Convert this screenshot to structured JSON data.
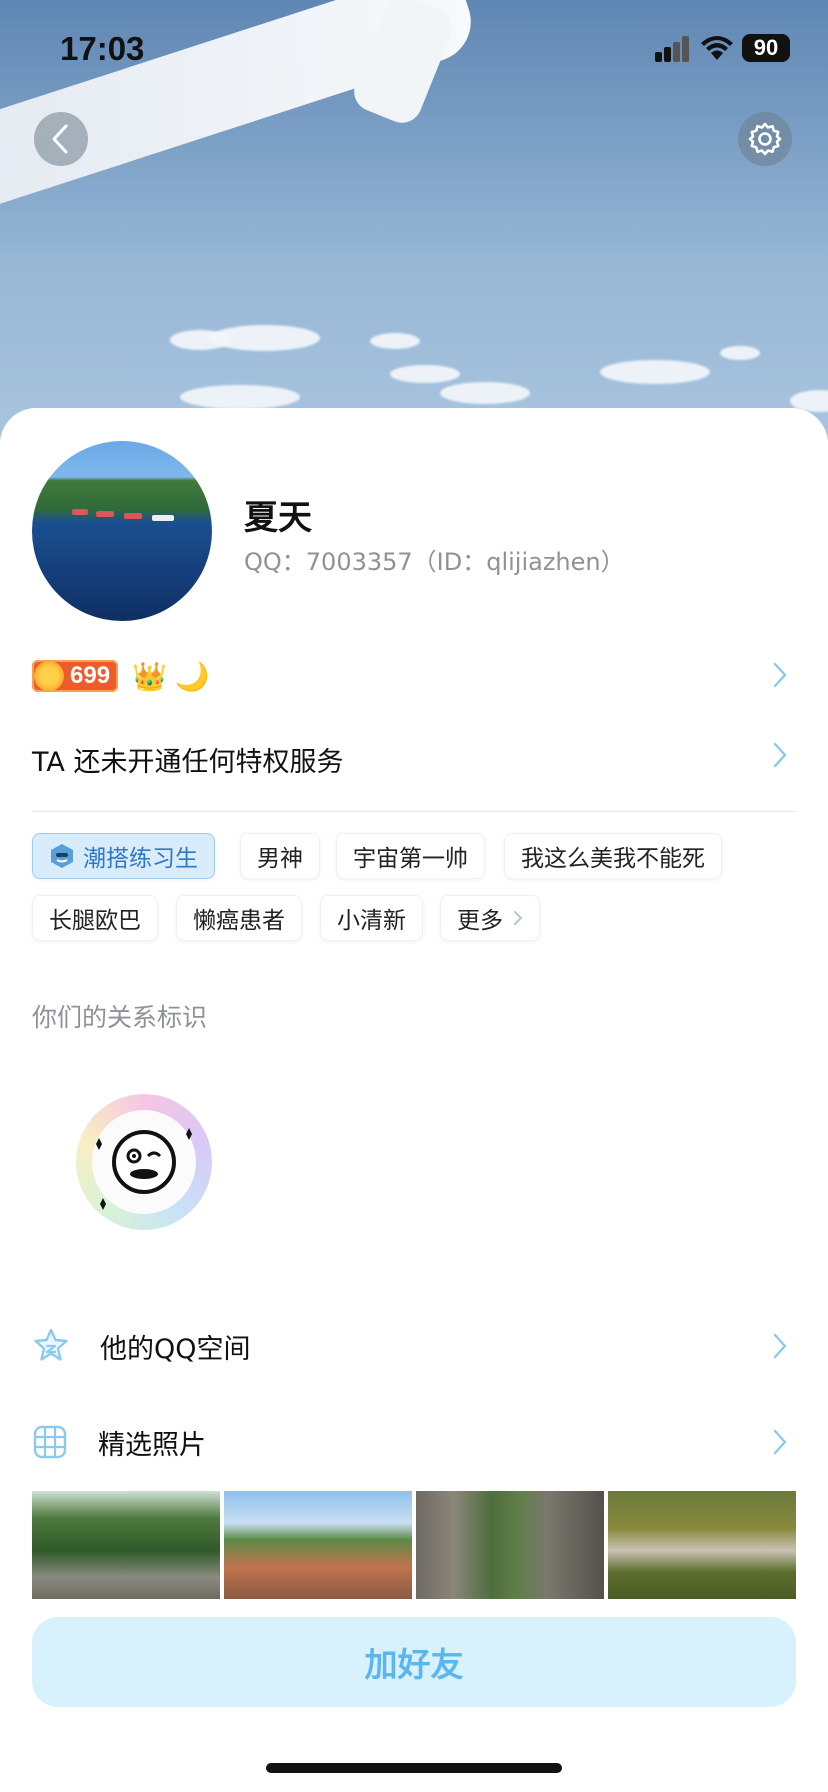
{
  "status_bar": {
    "time": "17:03",
    "battery": "90"
  },
  "profile": {
    "name": "夏天",
    "qq_line": "QQ：7003357（ID：qlijiazhen）",
    "level": "699"
  },
  "privilege_text": "TA 还未开通任何特权服务",
  "tags": {
    "primary": "潮搭练习生",
    "items": [
      "男神",
      "宇宙第一帅",
      "我这么美我不能死",
      "长腿欧巴",
      "懒癌患者",
      "小清新"
    ],
    "more": "更多"
  },
  "relationship_label": "你们的关系标识",
  "rows": {
    "qzone": "他的QQ空间",
    "photos": "精选照片"
  },
  "add_friend": "加好友",
  "icons": {
    "back": "back-chevron-icon",
    "settings": "gear-icon",
    "qzone": "star-icon",
    "photos": "grid-icon"
  },
  "colors": {
    "accent": "#5cb6ee",
    "chevron": "#8cc9ee",
    "tag_primary_bg": "#d9ecfb"
  }
}
